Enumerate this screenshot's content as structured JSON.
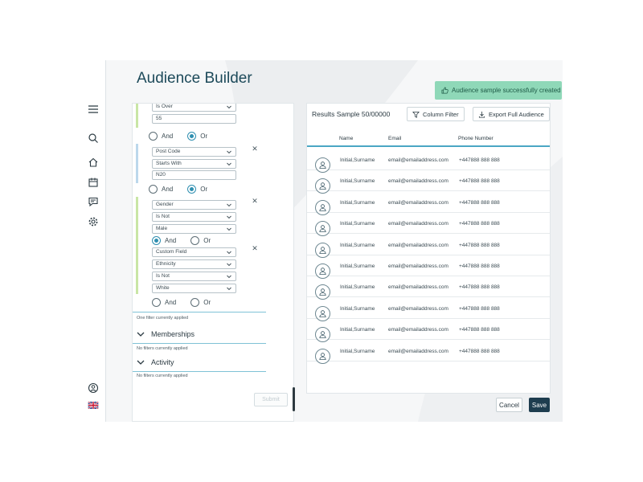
{
  "page": {
    "title": "Audience Builder"
  },
  "toast": {
    "text": "Audience sample successfully created",
    "icon": "thumbs-up-icon"
  },
  "rail": {
    "icons": [
      "menu-icon",
      "search-icon",
      "home-icon",
      "calendar-icon",
      "message-icon",
      "settings-icon",
      "user-circle-icon",
      "uk-flag-icon"
    ]
  },
  "filters": {
    "group1": {
      "operator": "Is Over",
      "value": "55"
    },
    "conj1": {
      "and_label": "And",
      "or_label": "Or",
      "selected": "Or"
    },
    "group2": {
      "field": "Post Code",
      "operator": "Starts With",
      "value": "N20"
    },
    "conj2": {
      "and_label": "And",
      "or_label": "Or",
      "selected": "Or"
    },
    "group3": {
      "field": "Gender",
      "operator": "Is Not",
      "value": "Male"
    },
    "conj3": {
      "and_label": "And",
      "or_label": "Or",
      "selected": "And"
    },
    "group4": {
      "field": "Custom Field",
      "subfield": "Ethnicity",
      "operator": "Is Not",
      "value": "White"
    },
    "conj4": {
      "and_label": "And",
      "or_label": "Or",
      "selected": ""
    },
    "applied_note": "One filter currently applied",
    "memberships": {
      "label": "Memberships",
      "note": "No filters currently applied"
    },
    "activity": {
      "label": "Activity",
      "note": "No filters currently applied"
    },
    "submit_label": "Submit"
  },
  "results": {
    "title": "Results Sample 50/00000",
    "column_filter_label": "Column Filter",
    "export_label": "Export Full Audience",
    "columns": {
      "name": "Name",
      "email": "Email",
      "phone": "Phone Number"
    },
    "rows": [
      {
        "name": "Initial,Surname",
        "email": "email@emailaddress.com",
        "phone": "+447888 888 888"
      },
      {
        "name": "Initial,Surname",
        "email": "email@emailaddress.com",
        "phone": "+447888 888 888"
      },
      {
        "name": "Initial,Surname",
        "email": "email@emailaddress.com",
        "phone": "+447888 888 888"
      },
      {
        "name": "Initial,Surname",
        "email": "email@emailaddress.com",
        "phone": "+447888 888 888"
      },
      {
        "name": "Initial,Surname",
        "email": "email@emailaddress.com",
        "phone": "+447888 888 888"
      },
      {
        "name": "Initial,Surname",
        "email": "email@emailaddress.com",
        "phone": "+447888 888 888"
      },
      {
        "name": "Initial,Surname",
        "email": "email@emailaddress.com",
        "phone": "+447888 888 888"
      },
      {
        "name": "Initial,Surname",
        "email": "email@emailaddress.com",
        "phone": "+447888 888 888"
      },
      {
        "name": "Initial,Surname",
        "email": "email@emailaddress.com",
        "phone": "+447888 888 888"
      },
      {
        "name": "Initial,Surname",
        "email": "email@emailaddress.com",
        "phone": "+447888 888 888"
      }
    ]
  },
  "actions": {
    "cancel_label": "Cancel",
    "save_label": "Save"
  },
  "colors": {
    "accent": "#2f8fb0",
    "primary_dark": "#1e3d4f",
    "toast_bg": "#8fd8b8",
    "green_bar": "#c9e6a6",
    "blue_bar": "#bcd8ec"
  }
}
